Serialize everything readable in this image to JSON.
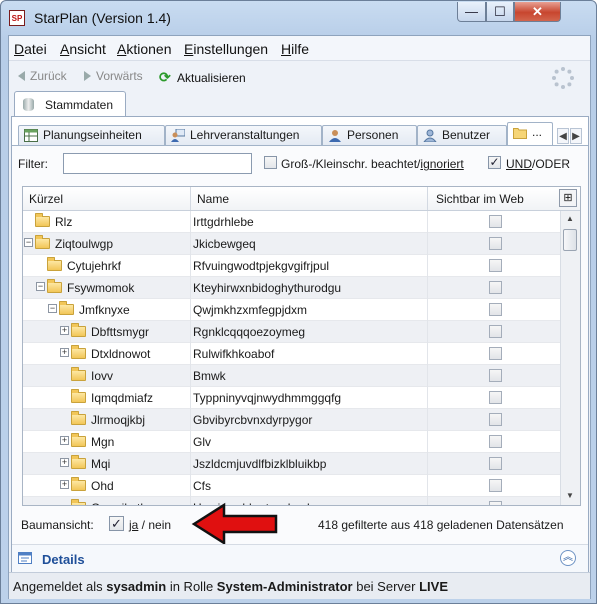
{
  "window": {
    "title": "StarPlan (Version 1.4)",
    "app_icon_text": "SP",
    "controls": {
      "minimize": "—",
      "maximize": "☐",
      "close": "✕"
    }
  },
  "menubar": {
    "items": [
      "Datei",
      "Ansicht",
      "Aktionen",
      "Einstellungen",
      "Hilfe"
    ]
  },
  "navbar": {
    "back": "Zurück",
    "forward": "Vorwärts",
    "refresh": "Aktualisieren"
  },
  "outer_tab": {
    "label": "Stammdaten"
  },
  "inner_tabs": [
    {
      "label": "Planungseinheiten",
      "icon": "table-icon"
    },
    {
      "label": "Lehrveranstaltungen",
      "icon": "teacher-icon"
    },
    {
      "label": "Personen",
      "icon": "person-icon"
    },
    {
      "label": "Benutzer",
      "icon": "user-icon"
    },
    {
      "label": "...",
      "icon": "folder-icon"
    }
  ],
  "filter": {
    "label": "Filter:",
    "value": "",
    "case_label_prefix": "Groß-/Kleinschr. beachtet/",
    "case_label_link": "ignoriert",
    "case_checked": false,
    "und_label": "UND",
    "oder_label": "/ODER",
    "und_checked": true
  },
  "table": {
    "columns": [
      "Kürzel",
      "Name",
      "Sichtbar im Web"
    ],
    "column_menu_icon": "⊞",
    "rows": [
      {
        "kurzel": "Rlz",
        "name": "Irttgdrhlebe",
        "level": 0,
        "expander": ""
      },
      {
        "kurzel": "Ziqtoulwgp",
        "name": "Jkicbewgeq",
        "level": 0,
        "expander": "−"
      },
      {
        "kurzel": "Cytujehrkf",
        "name": "Rfvuingwodtpjekgvgifrjpul",
        "level": 1,
        "expander": ""
      },
      {
        "kurzel": "Fsywmomok",
        "name": "Kteyhirwxnbidoghythurodgu",
        "level": 1,
        "expander": "−"
      },
      {
        "kurzel": "Jmfknyxe",
        "name": "Qwjmkhzxmfegpjdxm",
        "level": 2,
        "expander": "−"
      },
      {
        "kurzel": "Dbfttsmygr",
        "name": "Rgnklcqqqoezoymeg",
        "level": 3,
        "expander": "+"
      },
      {
        "kurzel": "Dtxldnowot",
        "name": "Rulwifkhkoabof",
        "level": 3,
        "expander": "+"
      },
      {
        "kurzel": "Iovv",
        "name": "Bmwk",
        "level": 3,
        "expander": ""
      },
      {
        "kurzel": "Iqmqdmiafz",
        "name": "Typpninyvqjnwydhmmggqfg",
        "level": 3,
        "expander": ""
      },
      {
        "kurzel": "Jlrmoqjkbj",
        "name": "Gbvibyrcbvnxdyrpygor",
        "level": 3,
        "expander": ""
      },
      {
        "kurzel": "Mgn",
        "name": "Glv",
        "level": 3,
        "expander": "+"
      },
      {
        "kurzel": "Mqi",
        "name": "Jszldcmjuvdlfbizklbluikbp",
        "level": 3,
        "expander": "+"
      },
      {
        "kurzel": "Ohd",
        "name": "Cfs",
        "level": 3,
        "expander": "+"
      },
      {
        "kurzel": "Qqwsibstk",
        "name": "Hyrzjwnuhbmtzuzknql",
        "level": 3,
        "expander": ""
      }
    ]
  },
  "tree_view": {
    "label": "Baumansicht:",
    "checked": true,
    "ja": "ja",
    "nein": " / nein"
  },
  "count_text": "418 gefilterte aus 418 geladenen Datensätzen",
  "details": {
    "label": "Details",
    "collapse_icon": "︽"
  },
  "status": {
    "prefix": "Angemeldet als ",
    "user": "sysadmin",
    "middle": " in Rolle ",
    "role": "System-Administrator",
    "server_prefix": " bei Server ",
    "server": "LIVE"
  },
  "colors": {
    "accent": "#1f4f99",
    "arrow": "#e01010",
    "window_frame": "#b7cde8"
  }
}
